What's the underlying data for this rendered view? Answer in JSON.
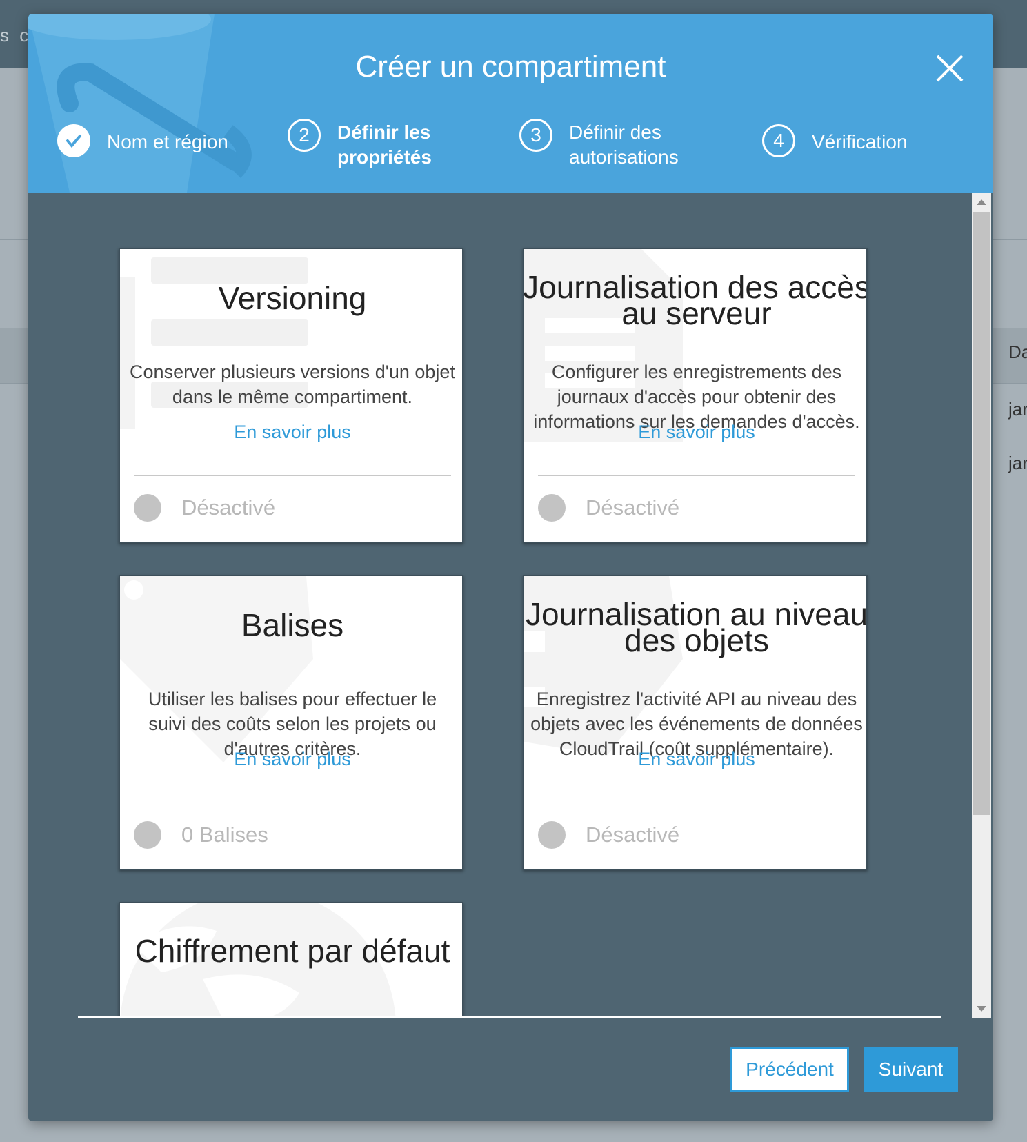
{
  "background": {
    "top_text": "s c",
    "side_texts": [
      "Da",
      "jar",
      "jar"
    ]
  },
  "modal": {
    "title": "Créer un compartiment",
    "steps": [
      {
        "number": "✓",
        "label": "Nom et région",
        "state": "done"
      },
      {
        "number": "2",
        "label": "Définir les propriétés",
        "state": "current"
      },
      {
        "number": "3",
        "label": "Définir des autorisations",
        "state": "pending"
      },
      {
        "number": "4",
        "label": "Vérification",
        "state": "pending"
      }
    ],
    "cards": [
      {
        "title": "Versioning",
        "description": "Conserver plusieurs versions d'un objet dans le même compartiment.",
        "link": "En savoir plus",
        "status": "Désactivé"
      },
      {
        "title": "Journalisation des accès au serveur",
        "description": "Configurer les enregistrements des journaux d'accès pour obtenir des informations sur les demandes d'accès.",
        "link": "En savoir plus",
        "status": "Désactivé"
      },
      {
        "title": "Balises",
        "description": "Utiliser les balises pour effectuer le suivi des coûts selon les projets ou d'autres critères.",
        "link": "En savoir plus",
        "status": "0 Balises"
      },
      {
        "title": "Journalisation au niveau des objets",
        "description": "Enregistrez l'activité API au niveau des objets avec les événements de données CloudTrail (coût supplémentaire).",
        "link": "En savoir plus",
        "status": "Désactivé"
      },
      {
        "title": "Chiffrement par défaut"
      }
    ],
    "buttons": {
      "previous": "Précédent",
      "next": "Suivant"
    }
  },
  "icons": {
    "close": "close-icon",
    "check": "check-icon"
  },
  "colors": {
    "header": "#4aa4dc",
    "body": "#4f6572",
    "accent": "#2e9ad8",
    "toggle_off": "#c3c3c3"
  }
}
